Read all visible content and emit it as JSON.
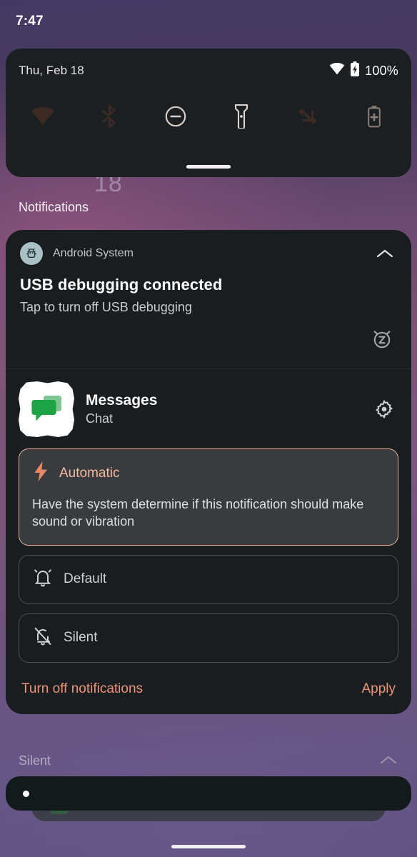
{
  "status_bar": {
    "clock": "7:47"
  },
  "quick_settings": {
    "date": "Thu, Feb 18",
    "battery_percent": "100%",
    "wifi_icon": "wifi-icon",
    "battery_icon": "battery-charging-icon",
    "drag_handle": "qs-drag-handle",
    "tiles": [
      {
        "name": "internet",
        "icon": "wifi-icon",
        "label": "Internet",
        "state": "on",
        "bg": "#f4a183",
        "fg": "#3d2a22"
      },
      {
        "name": "bluetooth",
        "icon": "bluetooth-icon",
        "label": "Bluetooth",
        "state": "on",
        "bg": "#f4a183",
        "fg": "#3d2a22"
      },
      {
        "name": "do-not-disturb",
        "icon": "dnd-icon",
        "label": "Do Not Disturb",
        "state": "off",
        "bg": "#4a3b33",
        "fg": "#d7cdc8"
      },
      {
        "name": "flashlight",
        "icon": "flashlight-icon",
        "label": "Flashlight",
        "state": "off",
        "bg": "#4a3b33",
        "fg": "#d7cdc8"
      },
      {
        "name": "auto-rotate",
        "icon": "auto-rotate-icon",
        "label": "Auto-rotate",
        "state": "on",
        "bg": "#f4a183",
        "fg": "#3d2a22"
      },
      {
        "name": "battery-saver",
        "icon": "battery-saver-icon",
        "label": "Battery Saver",
        "state": "off",
        "bg": "#4a3b33",
        "fg": "#8d7d76"
      }
    ]
  },
  "wallpaper": {
    "clock_remnant": "18"
  },
  "notifications": {
    "section_label": "Notifications",
    "usb": {
      "app_name": "Android System",
      "app_icon": "android-head-icon",
      "title": "USB debugging connected",
      "subtitle": "Tap to turn off USB debugging",
      "collapse_icon": "chevron-up-icon",
      "snooze_icon": "snooze-alarm-icon"
    },
    "messages": {
      "app_name": "Messages",
      "channel_name": "Chat",
      "app_icon": "messages-icon",
      "settings_icon": "gear-icon",
      "options": [
        {
          "id": "automatic",
          "label": "Automatic",
          "icon": "lightning-bolt-icon",
          "selected": true,
          "description": "Have the system determine if this notification should make sound or vibration"
        },
        {
          "id": "default",
          "label": "Default",
          "icon": "bell-ringing-icon",
          "selected": false,
          "description": ""
        },
        {
          "id": "silent",
          "label": "Silent",
          "icon": "bell-muted-icon",
          "selected": false,
          "description": ""
        }
      ],
      "actions": {
        "turn_off": "Turn off notifications",
        "apply": "Apply"
      }
    },
    "behind": {
      "silent_section_label": "Silent",
      "collapse_icon": "chevron-up-icon"
    }
  },
  "colors": {
    "accent": "#ee9577",
    "tile_on": "#f4a183",
    "tile_off": "#4a3b33",
    "panel_bg": "#1b1f22",
    "notif_bg": "#191d20",
    "selected_border": "#f0b49b",
    "selected_bg": "#393c3e",
    "messages_green": "#1ea446"
  },
  "nav": {
    "gesture_bar": "home-gesture-bar"
  }
}
